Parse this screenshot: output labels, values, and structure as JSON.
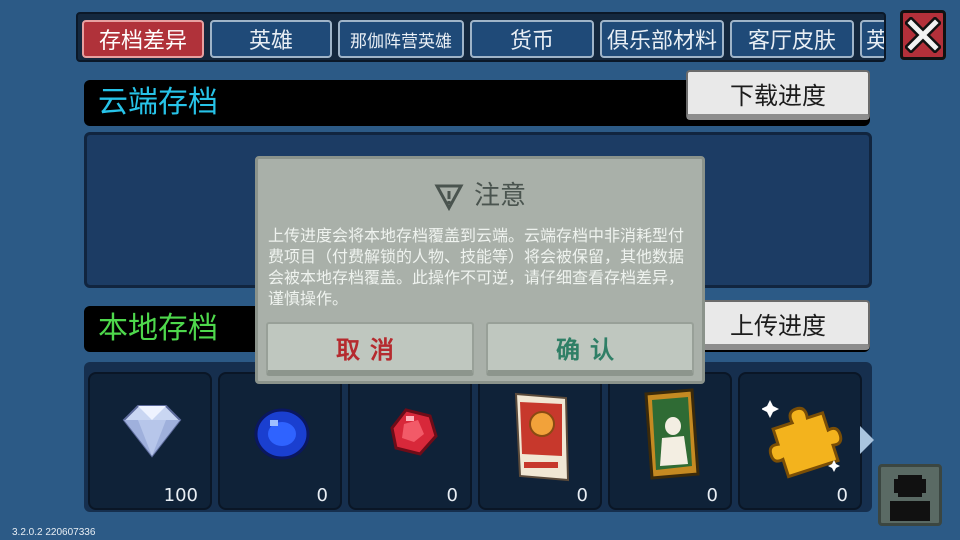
{
  "tabs": [
    {
      "label": "存档差异",
      "active": true
    },
    {
      "label": "英雄",
      "active": false
    },
    {
      "label": "那伽阵营英雄",
      "active": false
    },
    {
      "label": "货币",
      "active": false
    },
    {
      "label": "俱乐部材料",
      "active": false
    },
    {
      "label": "客厅皮肤",
      "active": false
    },
    {
      "label": "英",
      "active": false
    }
  ],
  "close_icon": "close-x-icon",
  "cloud": {
    "title": "云端存档",
    "download_label": "下载进度"
  },
  "local": {
    "title": "本地存档",
    "upload_label": "上传进度"
  },
  "items": [
    {
      "icon": "diamond-gem-icon",
      "count": "100"
    },
    {
      "icon": "blue-sapphire-icon",
      "count": "0"
    },
    {
      "icon": "red-ruby-icon",
      "count": "0"
    },
    {
      "icon": "seed-packet-icon",
      "count": "0"
    },
    {
      "icon": "skin-card-icon",
      "count": "0"
    },
    {
      "icon": "gold-puzzle-piece-icon",
      "count": "0"
    }
  ],
  "dialog": {
    "title": "注意",
    "body": "上传进度会将本地存档覆盖到云端。云端存档中非消耗型付费项目（付费解锁的人物、技能等）将会被保留，其他数据会被本地存档覆盖。此操作不可逆，请仔细查看存档差异，谨慎操作。",
    "cancel_label": "取消",
    "confirm_label": "确认"
  },
  "version": "3.2.0.2 220607336",
  "colors": {
    "background": "#2c5a86",
    "cloud_title": "#27c3e8",
    "local_title": "#4ed84c",
    "active_tab": "#b0323a",
    "cancel": "#b52a2e",
    "confirm": "#2f7f66"
  }
}
